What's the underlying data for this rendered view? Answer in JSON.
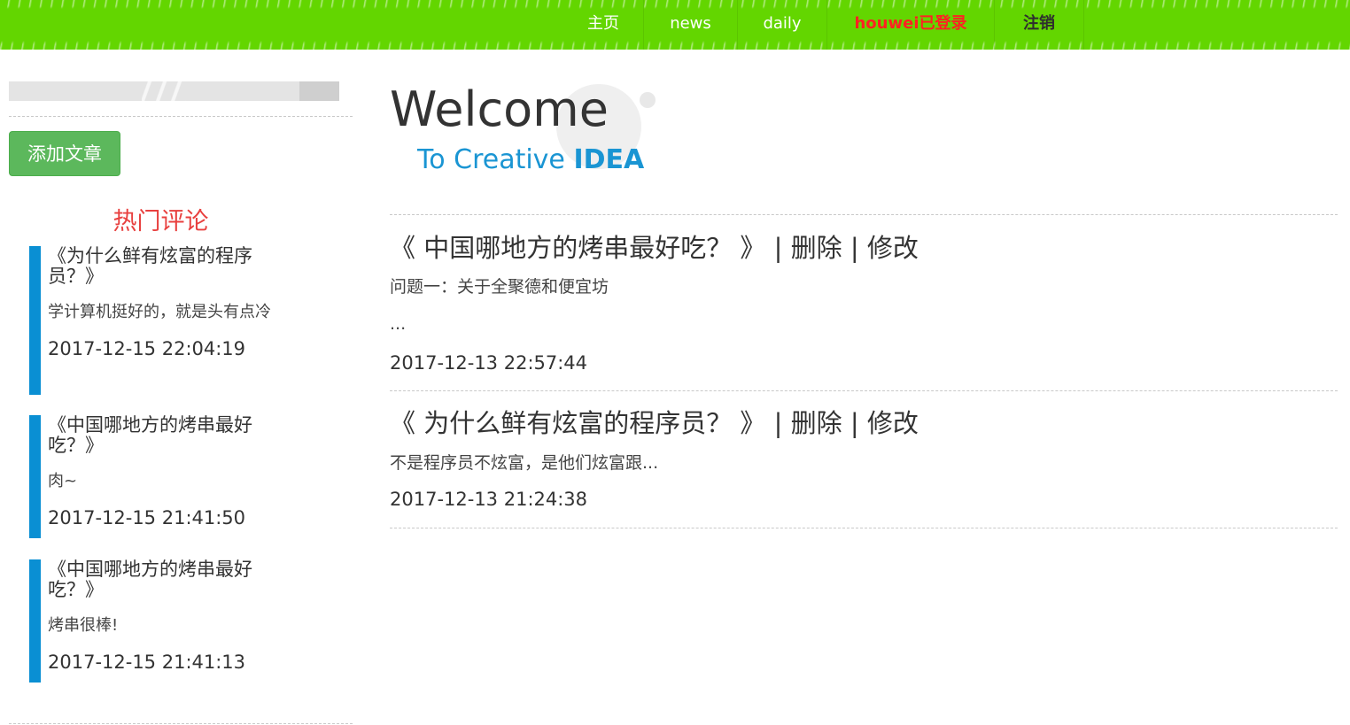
{
  "nav": {
    "items": [
      {
        "label": "主页"
      },
      {
        "label": "news"
      },
      {
        "label": "daily"
      },
      {
        "label": "houwei已登录"
      },
      {
        "label": "注销"
      }
    ]
  },
  "colors": {
    "nav_bg": "#63d600",
    "accent_blue": "#0a8fd3",
    "hot_title": "#e8403f",
    "add_button": "#5cb85c",
    "logged_in_user": "#ff2222"
  },
  "sidebar": {
    "add_article_label": "添加文章",
    "hot_comments_title": "热门评论",
    "comments": [
      {
        "title": "《为什么鲜有炫富的程序员？》",
        "body": "学计算机挺好的，就是头有点冷",
        "date": "2017-12-15 22:04:19"
      },
      {
        "title": "《中国哪地方的烤串最好吃？》",
        "body": "肉~",
        "date": "2017-12-15 21:41:50"
      },
      {
        "title": "《中国哪地方的烤串最好吃？》",
        "body": "烤串很棒!",
        "date": "2017-12-15 21:41:13"
      }
    ]
  },
  "main": {
    "welcome": "Welcome",
    "tagline_prefix": "To Creative",
    "tagline_emph": "IDEA",
    "articles": [
      {
        "title": "《 中国哪地方的烤串最好吃？ 》",
        "delete_label": "删除",
        "edit_label": "修改",
        "excerpt": "问题一：关于全聚德和便宜坊",
        "ellipsis": "...",
        "date": "2017-12-13 22:57:44"
      },
      {
        "title": "《 为什么鲜有炫富的程序员？ 》",
        "delete_label": "删除",
        "edit_label": "修改",
        "excerpt": "不是程序员不炫富，是他们炫富跟...",
        "date": "2017-12-13 21:24:38"
      }
    ],
    "separator": "|"
  }
}
